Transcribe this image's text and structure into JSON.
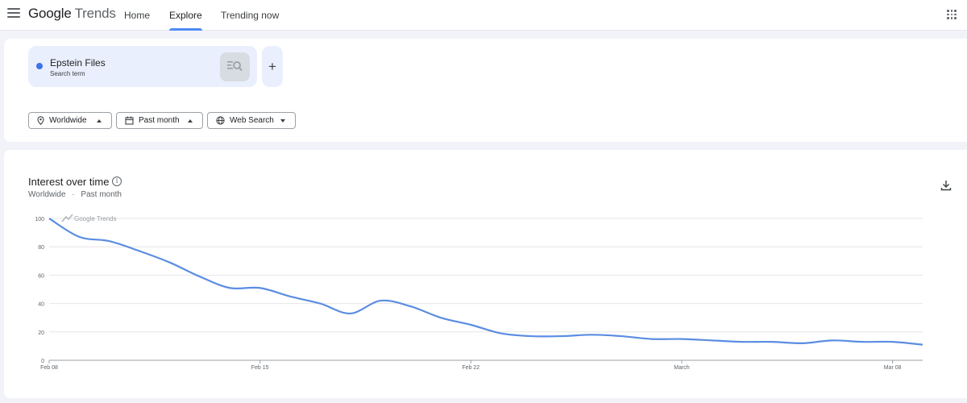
{
  "header": {
    "logo_brand": "Google",
    "logo_product": "Trends",
    "nav": [
      {
        "label": "Home",
        "active": false
      },
      {
        "label": "Explore",
        "active": true
      },
      {
        "label": "Trending now",
        "active": false
      }
    ]
  },
  "search": {
    "term": "Epstein Files",
    "term_type": "Search term",
    "term_color": "#3c73e9",
    "add_label": "+"
  },
  "filters": {
    "location": "Worldwide",
    "time_range": "Past month",
    "property": "Web Search"
  },
  "chart_section": {
    "title": "Interest over time",
    "subtitle_location": "Worldwide",
    "subtitle_separator": "·",
    "subtitle_time": "Past month",
    "watermark": "Google Trends"
  },
  "chart_data": {
    "type": "line",
    "title": "Interest over time",
    "xlabel": "",
    "ylabel": "",
    "ylim": [
      0,
      100
    ],
    "yticks": [
      0,
      20,
      40,
      60,
      80,
      100
    ],
    "x_tick_labels": [
      "Feb 08",
      "Feb 15",
      "Feb 22",
      "March",
      "Mar 08"
    ],
    "x_tick_index": [
      0,
      7,
      14,
      21,
      28
    ],
    "grid": true,
    "line_color": "#5b8de2",
    "series": [
      {
        "name": "Epstein Files",
        "x": [
          "Feb 08",
          "Feb 09",
          "Feb 10",
          "Feb 11",
          "Feb 12",
          "Feb 13",
          "Feb 14",
          "Feb 15",
          "Feb 16",
          "Feb 17",
          "Feb 18",
          "Feb 19",
          "Feb 20",
          "Feb 21",
          "Feb 22",
          "Feb 23",
          "Feb 24",
          "Feb 25",
          "Feb 26",
          "Feb 27",
          "Feb 28",
          "Mar 01",
          "Mar 02",
          "Mar 03",
          "Mar 04",
          "Mar 05",
          "Mar 06",
          "Mar 07",
          "Mar 08",
          "Mar 09"
        ],
        "values": [
          100,
          87,
          84,
          77,
          69,
          59,
          51,
          51,
          45,
          40,
          33,
          42,
          38,
          30,
          25,
          19,
          17,
          17,
          18,
          17,
          15,
          15,
          14,
          13,
          13,
          12,
          14,
          13,
          13,
          11
        ]
      }
    ]
  }
}
